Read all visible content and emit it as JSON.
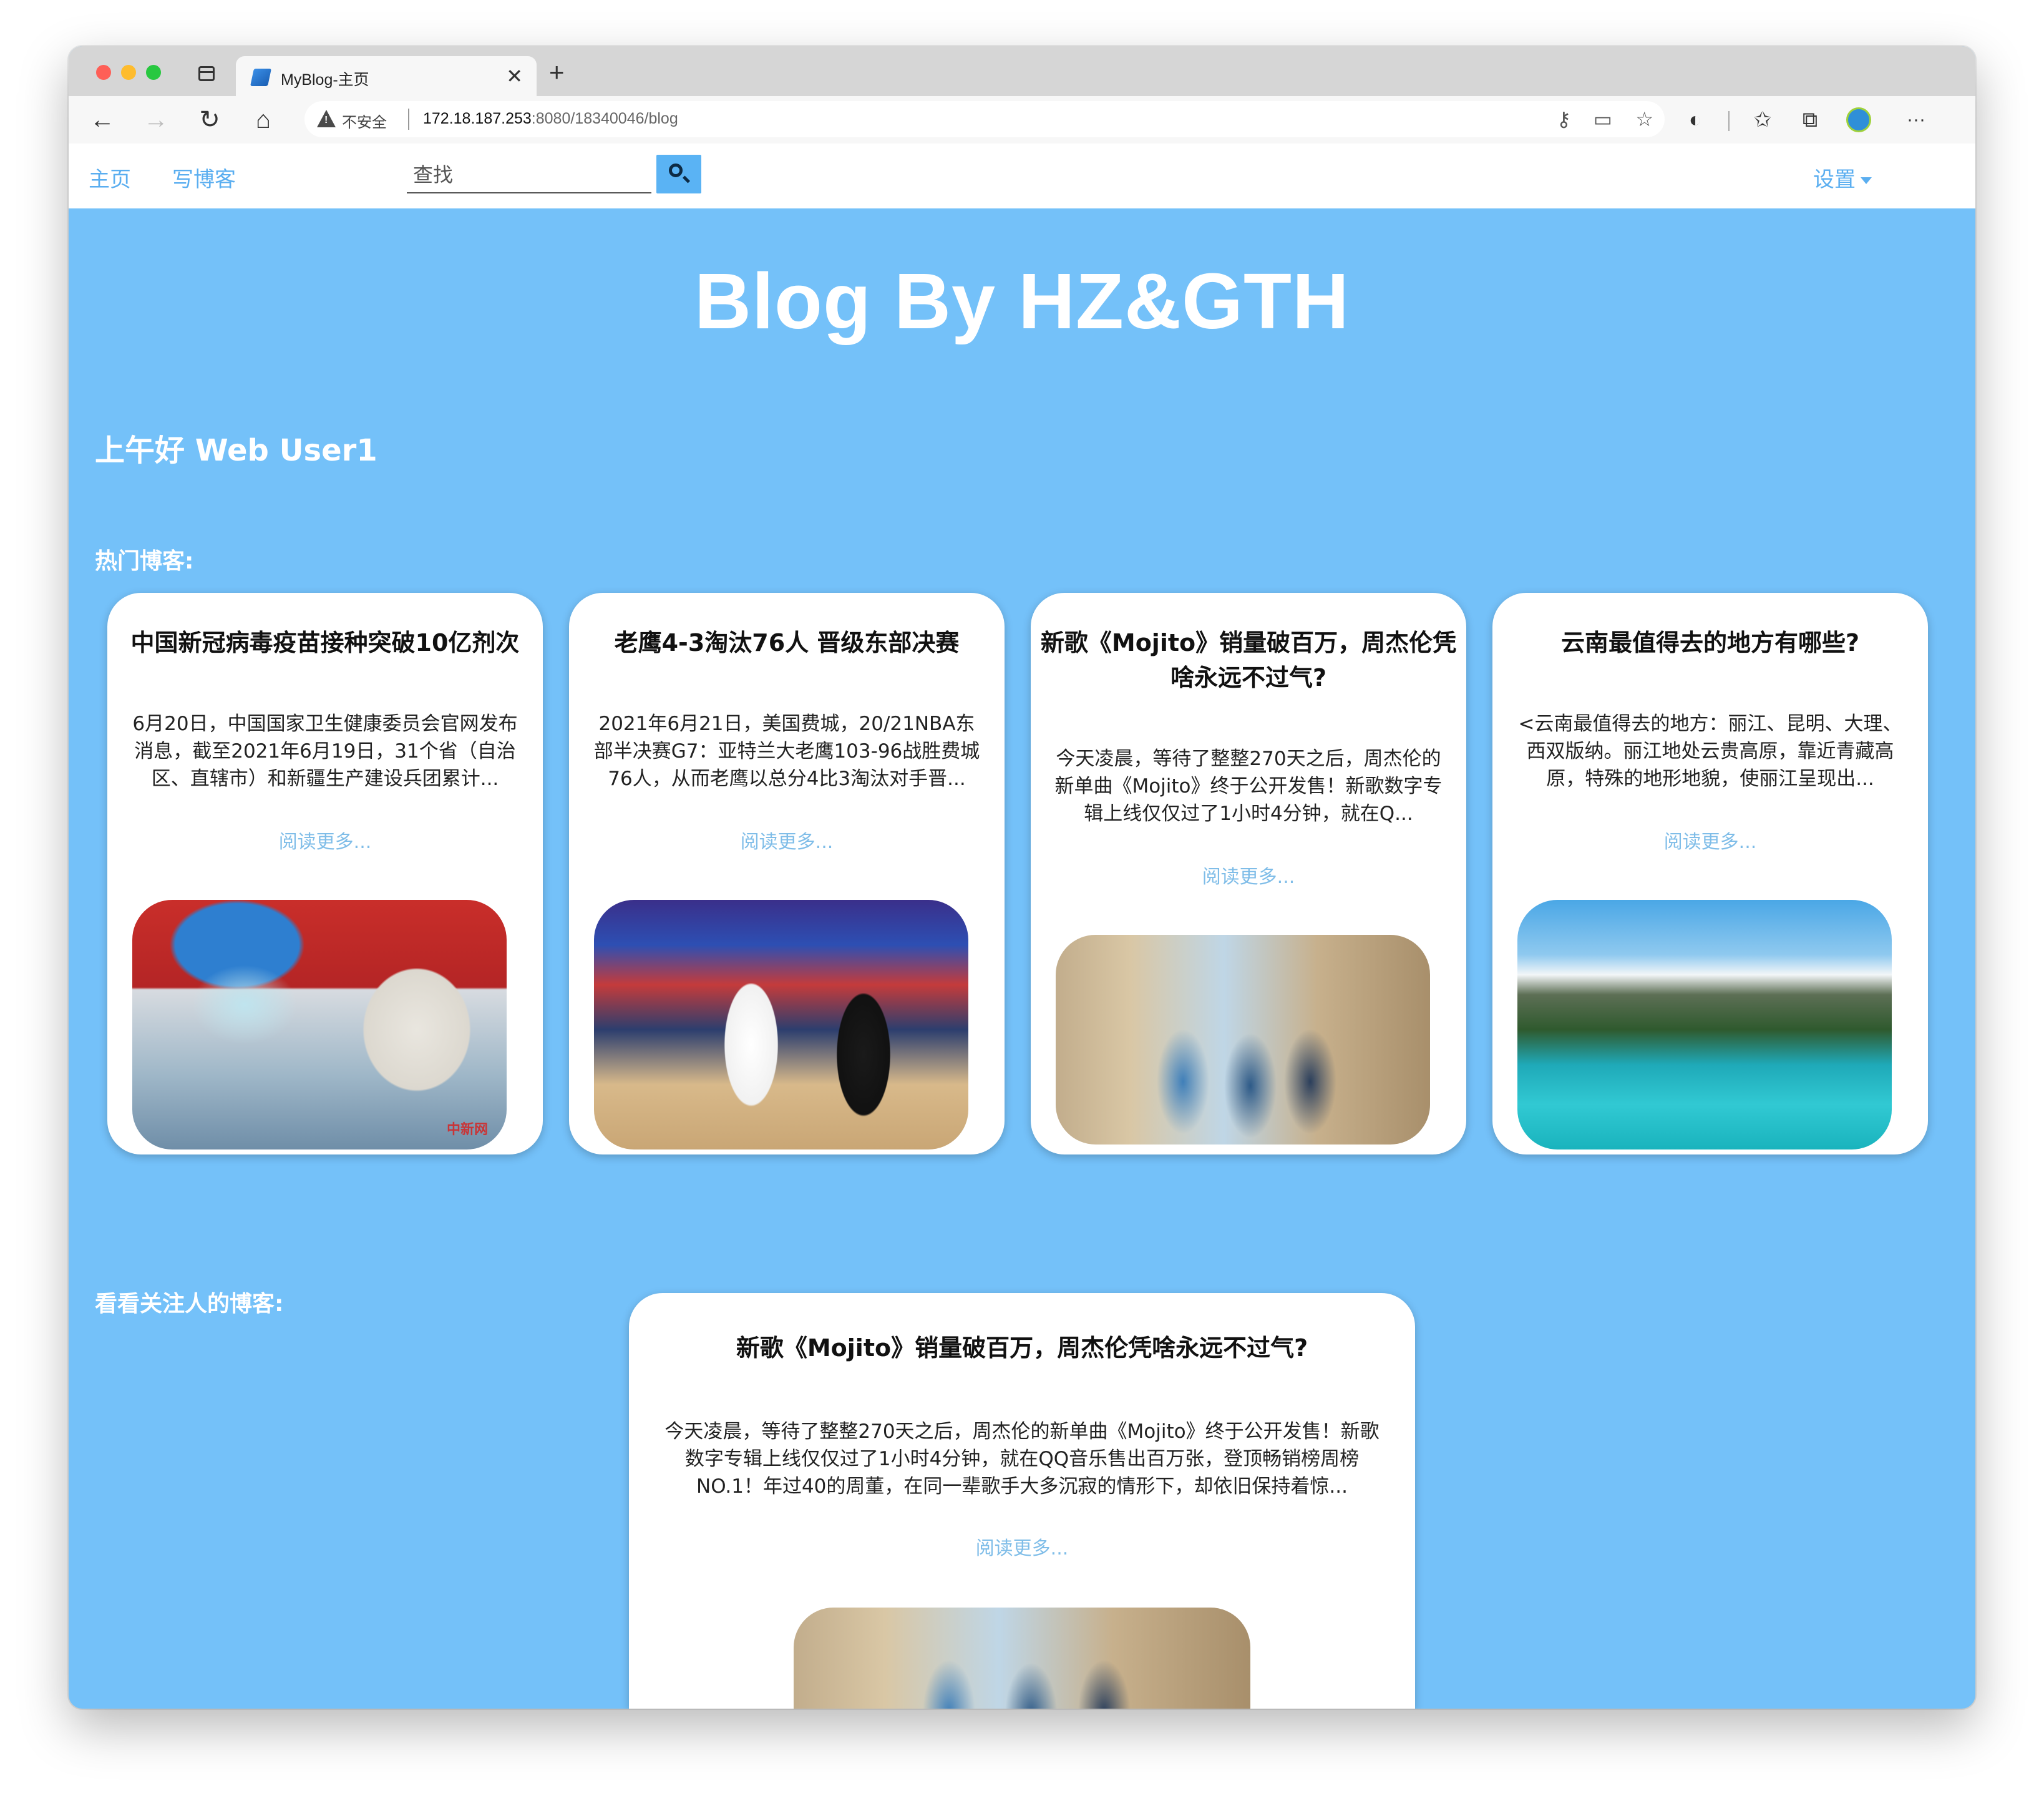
{
  "browser": {
    "tab_title": "MyBlog-主页",
    "security_label": "不安全",
    "url_host": "172.18.187.253",
    "url_rest": ":8080/18340046/blog"
  },
  "nav": {
    "home": "主页",
    "write": "写博客",
    "search_placeholder": "查找",
    "settings": "设置"
  },
  "hero": {
    "title": "Blog By HZ&GTH"
  },
  "greeting": "上午好 Web User1",
  "sections": {
    "hot": "热门博客:",
    "following": "看看关注人的博客:"
  },
  "hot_posts": [
    {
      "title": "中国新冠病毒疫苗接种突破10亿剂次",
      "excerpt": "6月20日，中国国家卫生健康委员会官网发布消息，截至2021年6月19日，31个省（自治区、直辖市）和新疆生产建设兵团累计...",
      "read_more": "阅读更多...",
      "image_watermark": "中新网"
    },
    {
      "title": "老鹰4-3淘汰76人 晋级东部决赛",
      "excerpt": "2021年6月21日，美国费城，20/21NBA东部半决赛G7：亚特兰大老鹰103-96战胜费城76人，从而老鹰以总分4比3淘汰对手晋...",
      "read_more": "阅读更多..."
    },
    {
      "title": "新歌《Mojito》销量破百万，周杰伦凭啥永远不过气?",
      "excerpt": "今天凌晨，等待了整整270天之后，周杰伦的新单曲《Mojito》终于公开发售！新歌数字专辑上线仅仅过了1小时4分钟，就在Q...",
      "read_more": "阅读更多..."
    },
    {
      "title": "云南最值得去的地方有哪些?",
      "excerpt": "<云南最值得去的地方：丽江、昆明、大理、西双版纳。丽江地处云贵高原，靠近青藏高原，特殊的地形地貌，使丽江呈现出...",
      "read_more": "阅读更多..."
    }
  ],
  "following_posts": [
    {
      "title": "新歌《Mojito》销量破百万，周杰伦凭啥永远不过气?",
      "excerpt": "今天凌晨，等待了整整270天之后，周杰伦的新单曲《Mojito》终于公开发售！新歌数字专辑上线仅仅过了1小时4分钟，就在QQ音乐售出百万张，登顶畅销榜周榜NO.1！年过40的周董，在同一辈歌手大多沉寂的情形下，却依旧保持着惊...",
      "read_more": "阅读更多..."
    }
  ],
  "colors": {
    "page_bg": "#74c1f9",
    "link": "#5aaef0",
    "read_more": "#7fbde8"
  }
}
